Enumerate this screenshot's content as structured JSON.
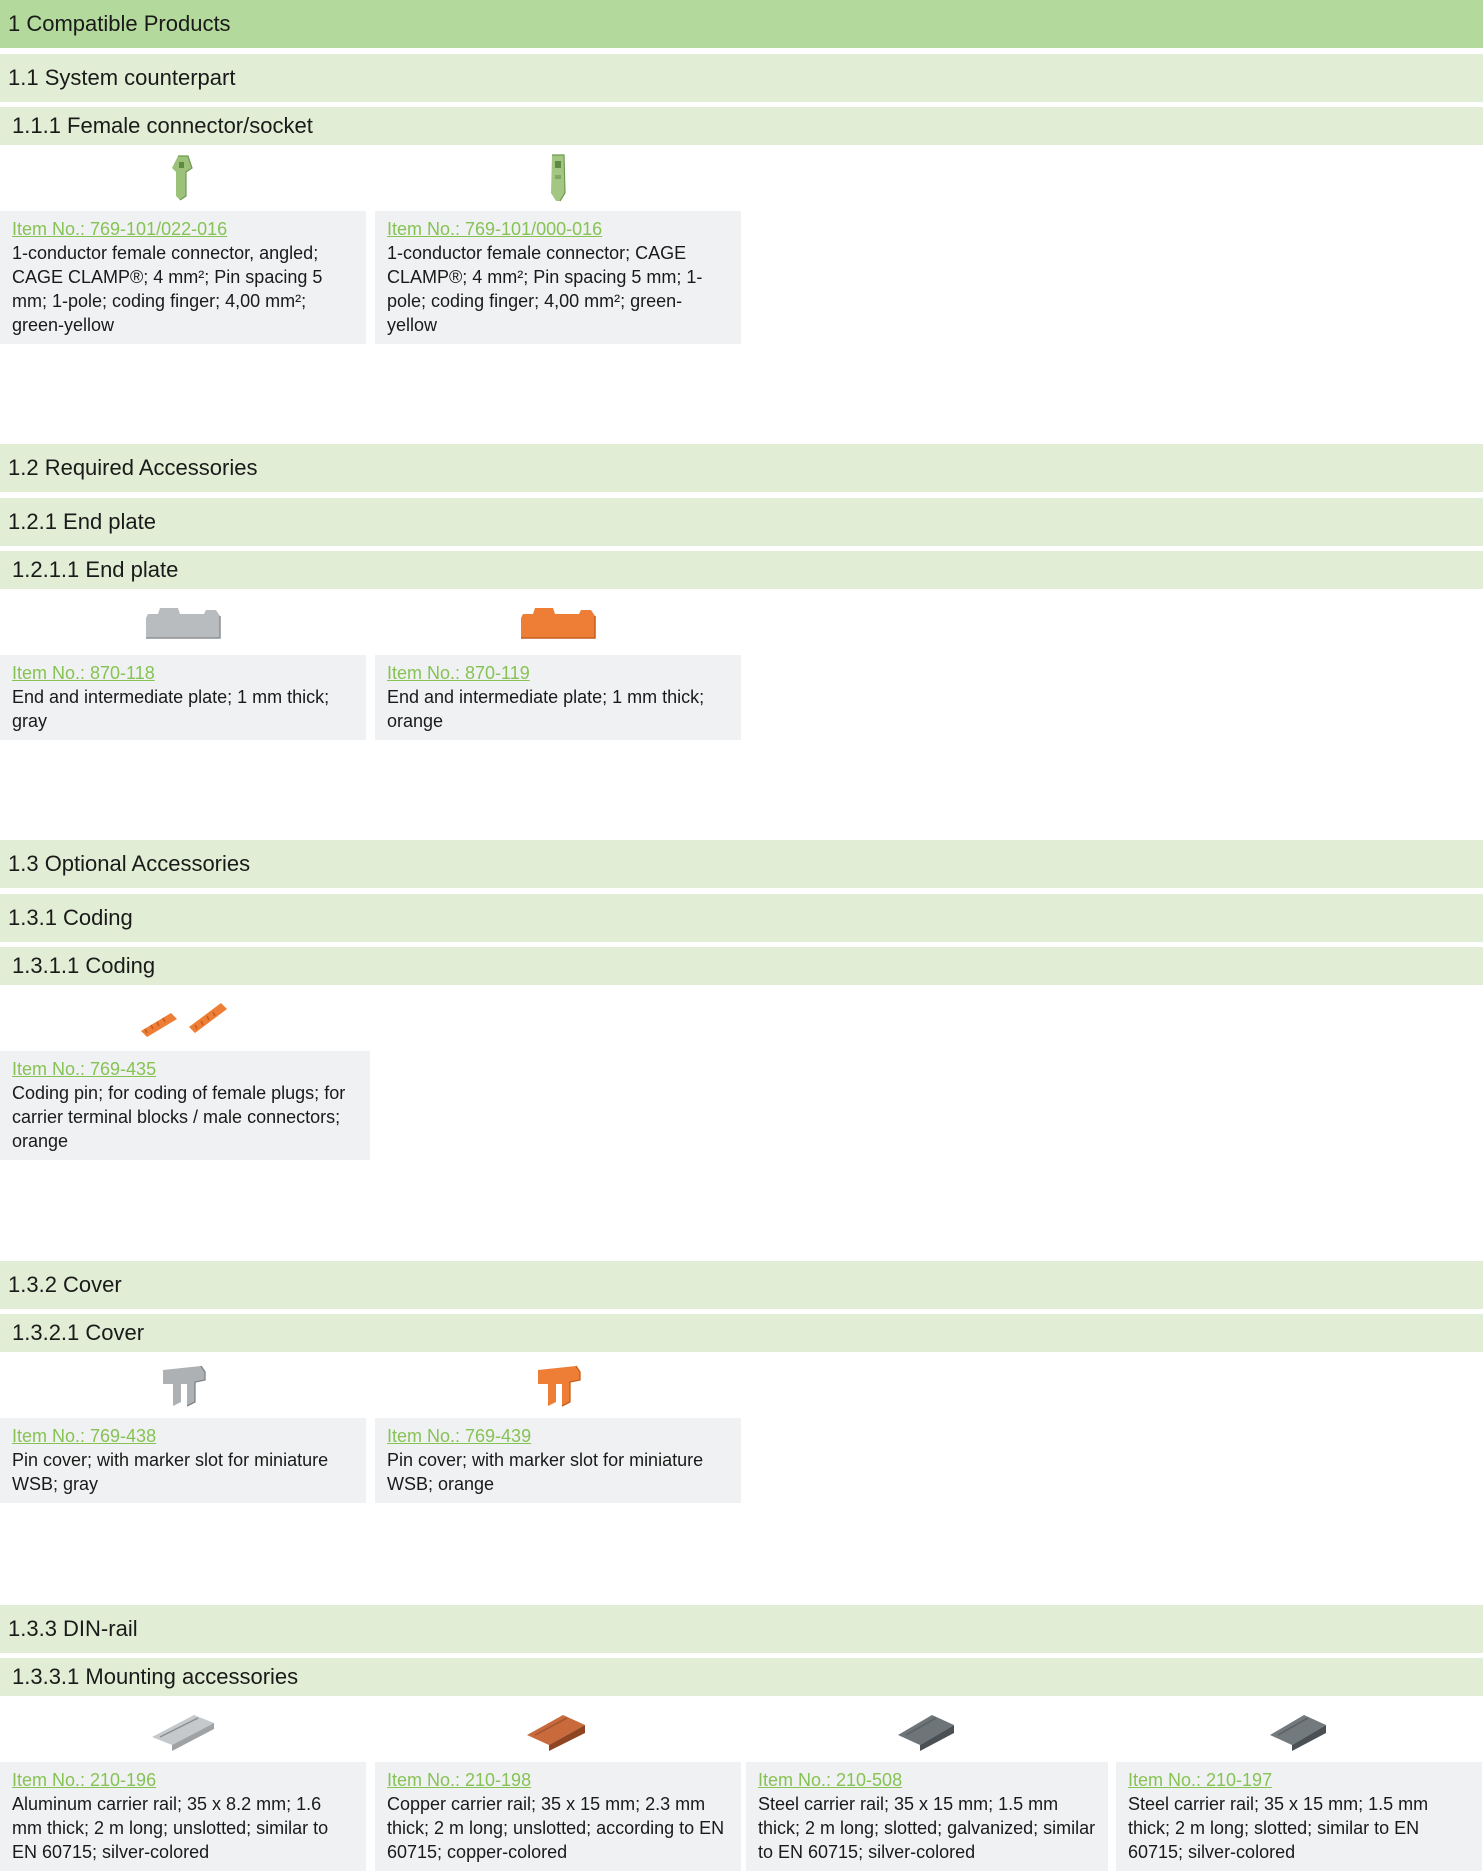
{
  "sections": {
    "s1": "1 Compatible Products",
    "s1_1": "1.1 System counterpart",
    "s1_1_1": "1.1.1 Female connector/socket",
    "s1_2": "1.2 Required Accessories",
    "s1_2_1": "1.2.1 End plate",
    "s1_2_1_1": "1.2.1.1 End plate",
    "s1_3": "1.3 Optional Accessories",
    "s1_3_1": "1.3.1 Coding",
    "s1_3_1_1": "1.3.1.1 Coding",
    "s1_3_2": "1.3.2 Cover",
    "s1_3_2_1": "1.3.2.1 Cover",
    "s1_3_3": "1.3.3 DIN-rail",
    "s1_3_3_1": "1.3.3.1 Mounting accessories"
  },
  "colors": {
    "header_main": "#b3d99c",
    "header_sub": "#e1eed5",
    "link": "#86c354",
    "card_bg": "#f0f1f2"
  },
  "products": {
    "female_connectors": [
      {
        "item": "Item No.: 769-101/022-016",
        "desc": "1-conductor female connector, angled; CAGE CLAMP®; 4 mm²; Pin spacing 5 mm; 1-pole; coding finger; 4,00 mm²; green-yellow",
        "icon": "angled-female-connector-icon"
      },
      {
        "item": "Item No.: 769-101/000-016",
        "desc": "1-conductor female connector; CAGE CLAMP®; 4 mm²; Pin spacing 5 mm; 1-pole; coding finger; 4,00 mm²; green-yellow",
        "icon": "female-connector-icon"
      }
    ],
    "end_plates": [
      {
        "item": "Item No.: 870-118",
        "desc": "End and intermediate plate; 1 mm thick; gray",
        "icon": "end-plate-gray-icon"
      },
      {
        "item": "Item No.: 870-119",
        "desc": "End and intermediate plate; 1 mm thick; orange",
        "icon": "end-plate-orange-icon"
      }
    ],
    "coding": [
      {
        "item": "Item No.: 769-435",
        "desc": "Coding pin; for coding of female plugs; for carrier terminal blocks / male connectors; orange",
        "icon": "coding-pin-icon"
      }
    ],
    "covers": [
      {
        "item": "Item No.: 769-438",
        "desc": "Pin cover; with marker slot for miniature WSB; gray",
        "icon": "pin-cover-gray-icon"
      },
      {
        "item": "Item No.: 769-439",
        "desc": "Pin cover; with marker slot for miniature WSB; orange",
        "icon": "pin-cover-orange-icon"
      }
    ],
    "din_rails": [
      {
        "item": "Item No.: 210-196",
        "desc": "Aluminum carrier rail; 35 x 8.2 mm; 1.6 mm thick; 2 m long; unslotted; similar to EN 60715; silver-colored",
        "icon": "aluminum-rail-icon"
      },
      {
        "item": "Item No.: 210-198",
        "desc": "Copper carrier rail; 35 x 15 mm; 2.3 mm thick; 2 m long; unslotted; according to EN 60715; copper-colored",
        "icon": "copper-rail-icon"
      },
      {
        "item": "Item No.: 210-508",
        "desc": "Steel carrier rail; 35 x 15 mm; 1.5 mm thick; 2 m long; slotted; galvanized; similar to EN 60715; silver-colored",
        "icon": "steel-rail-icon"
      },
      {
        "item": "Item No.: 210-197",
        "desc": "Steel carrier rail; 35 x 15 mm; 1.5 mm thick; 2 m long; slotted; similar to EN 60715; silver-colored",
        "icon": "steel-rail-icon"
      }
    ]
  }
}
